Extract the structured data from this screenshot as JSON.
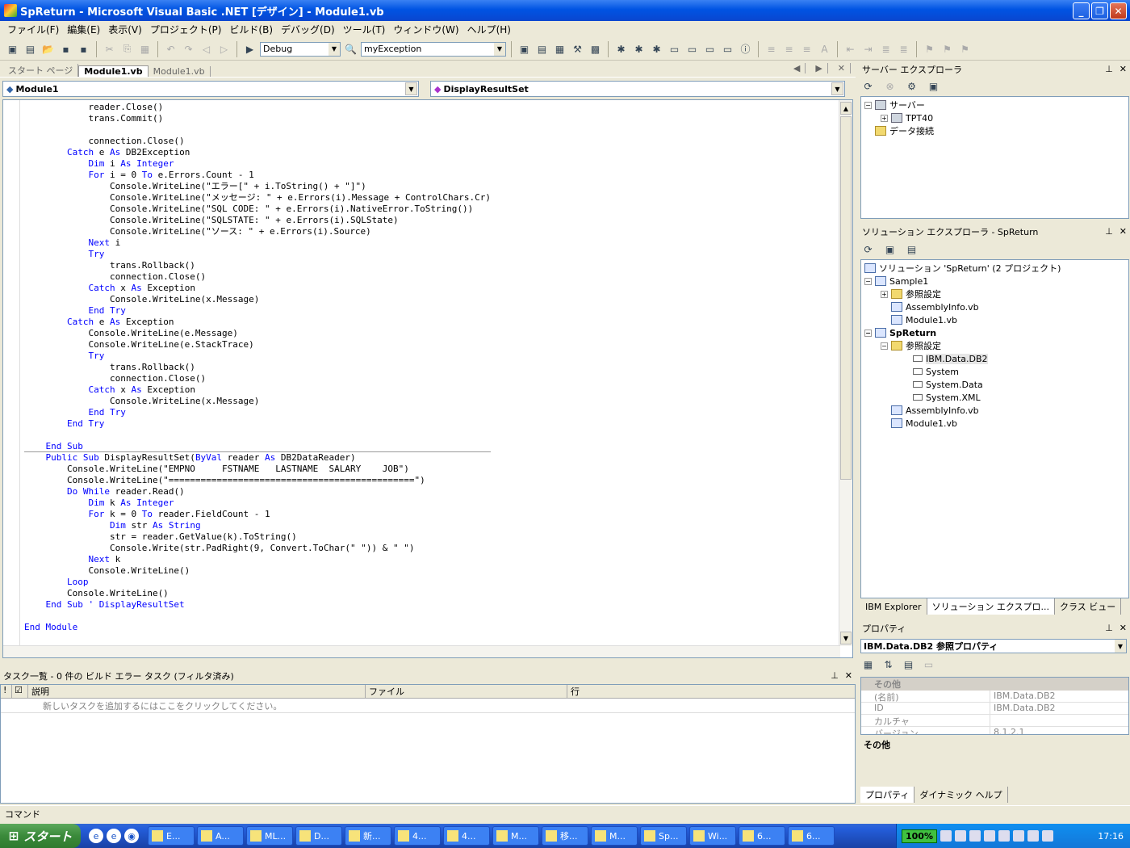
{
  "window": {
    "title": "SpReturn - Microsoft Visual Basic .NET [デザイン] - Module1.vb",
    "min": "_",
    "max": "❐",
    "close": "✕"
  },
  "menu": [
    "ファイル(F)",
    "編集(E)",
    "表示(V)",
    "プロジェクト(P)",
    "ビルド(B)",
    "デバッグ(D)",
    "ツール(T)",
    "ウィンドウ(W)",
    "ヘルプ(H)"
  ],
  "toolbar": {
    "config": "Debug",
    "find": "myException"
  },
  "doc_tabs": [
    "スタート ページ",
    "Module1.vb",
    "Module1.vb"
  ],
  "nav": {
    "left": "Module1",
    "right": "DisplayResultSet"
  },
  "code_lines": [
    [
      [
        "",
        "            reader.Close()"
      ]
    ],
    [
      [
        "",
        "            trans.Commit()"
      ]
    ],
    [
      [
        "",
        ""
      ]
    ],
    [
      [
        "",
        "            connection.Close()"
      ]
    ],
    [
      [
        "k",
        "        Catch"
      ],
      [
        "",
        " e "
      ],
      [
        "k",
        "As"
      ],
      [
        "",
        " DB2Exception"
      ]
    ],
    [
      [
        "k",
        "            Dim"
      ],
      [
        "",
        " i "
      ],
      [
        "k",
        "As Integer"
      ]
    ],
    [
      [
        "k",
        "            For"
      ],
      [
        "",
        " i = 0 "
      ],
      [
        "k",
        "To"
      ],
      [
        "",
        " e.Errors.Count - 1"
      ]
    ],
    [
      [
        "",
        "                Console.WriteLine(\"エラー[\" + i.ToString() + \"]\")"
      ]
    ],
    [
      [
        "",
        "                Console.WriteLine(\"メッセージ: \" + e.Errors(i).Message + ControlChars.Cr)"
      ]
    ],
    [
      [
        "",
        "                Console.WriteLine(\"SQL CODE: \" + e.Errors(i).NativeError.ToString())"
      ]
    ],
    [
      [
        "",
        "                Console.WriteLine(\"SQLSTATE: \" + e.Errors(i).SQLState)"
      ]
    ],
    [
      [
        "",
        "                Console.WriteLine(\"ソース: \" + e.Errors(i).Source)"
      ]
    ],
    [
      [
        "k",
        "            Next"
      ],
      [
        "",
        " i"
      ]
    ],
    [
      [
        "k",
        "            Try"
      ]
    ],
    [
      [
        "",
        "                trans.Rollback()"
      ]
    ],
    [
      [
        "",
        "                connection.Close()"
      ]
    ],
    [
      [
        "k",
        "            Catch"
      ],
      [
        "",
        " x "
      ],
      [
        "k",
        "As"
      ],
      [
        "",
        " Exception"
      ]
    ],
    [
      [
        "",
        "                Console.WriteLine(x.Message)"
      ]
    ],
    [
      [
        "k",
        "            End Try"
      ]
    ],
    [
      [
        "k",
        "        Catch"
      ],
      [
        "",
        " e "
      ],
      [
        "k",
        "As"
      ],
      [
        "",
        " Exception"
      ]
    ],
    [
      [
        "",
        "            Console.WriteLine(e.Message)"
      ]
    ],
    [
      [
        "",
        "            Console.WriteLine(e.StackTrace)"
      ]
    ],
    [
      [
        "k",
        "            Try"
      ]
    ],
    [
      [
        "",
        "                trans.Rollback()"
      ]
    ],
    [
      [
        "",
        "                connection.Close()"
      ]
    ],
    [
      [
        "k",
        "            Catch"
      ],
      [
        "",
        " x "
      ],
      [
        "k",
        "As"
      ],
      [
        "",
        " Exception"
      ]
    ],
    [
      [
        "",
        "                Console.WriteLine(x.Message)"
      ]
    ],
    [
      [
        "k",
        "            End Try"
      ]
    ],
    [
      [
        "k",
        "        End Try"
      ]
    ],
    [
      [
        "",
        ""
      ]
    ],
    [
      [
        "k",
        "    End Sub"
      ]
    ],
    [
      [
        "k",
        "    Public Sub"
      ],
      [
        "",
        " DisplayResultSet("
      ],
      [
        "k",
        "ByVal"
      ],
      [
        "",
        " reader "
      ],
      [
        "k",
        "As"
      ],
      [
        "",
        " DB2DataReader)"
      ]
    ],
    [
      [
        "",
        "        Console.WriteLine(\"EMPNO     FSTNAME   LASTNAME  SALARY    JOB\")"
      ]
    ],
    [
      [
        "",
        "        Console.WriteLine(\"==============================================\")"
      ]
    ],
    [
      [
        "k",
        "        Do While"
      ],
      [
        "",
        " reader.Read()"
      ]
    ],
    [
      [
        "k",
        "            Dim"
      ],
      [
        "",
        " k "
      ],
      [
        "k",
        "As Integer"
      ]
    ],
    [
      [
        "k",
        "            For"
      ],
      [
        "",
        " k = 0 "
      ],
      [
        "k",
        "To"
      ],
      [
        "",
        " reader.FieldCount - 1"
      ]
    ],
    [
      [
        "k",
        "                Dim"
      ],
      [
        "",
        " str "
      ],
      [
        "k",
        "As String"
      ]
    ],
    [
      [
        "",
        "                str = reader.GetValue(k).ToString()"
      ]
    ],
    [
      [
        "",
        "                Console.Write(str.PadRight(9, Convert.ToChar(\" \")) & \" \")"
      ]
    ],
    [
      [
        "k",
        "            Next"
      ],
      [
        "",
        " k"
      ]
    ],
    [
      [
        "",
        "            Console.WriteLine()"
      ]
    ],
    [
      [
        "k",
        "        Loop"
      ]
    ],
    [
      [
        "",
        "        Console.WriteLine()"
      ]
    ],
    [
      [
        "k",
        "    End Sub ' DisplayResultSet"
      ]
    ],
    [
      [
        "",
        ""
      ]
    ],
    [
      [
        "k",
        "End Module"
      ]
    ]
  ],
  "server_explorer": {
    "title": "サーバー エクスプローラ",
    "items": [
      "サーバー",
      "TPT40",
      "データ接続"
    ]
  },
  "solution_explorer": {
    "title": "ソリューション エクスプローラ - SpReturn",
    "items": [
      "ソリューション 'SpReturn' (2 プロジェクト)",
      "Sample1",
      "参照設定",
      "AssemblyInfo.vb",
      "Module1.vb",
      "SpReturn",
      "参照設定",
      "IBM.Data.DB2",
      "System",
      "System.Data",
      "System.XML",
      "AssemblyInfo.vb",
      "Module1.vb"
    ]
  },
  "right_tabs": [
    "IBM Explorer",
    "ソリューション エクスプロ...",
    "クラス ビュー"
  ],
  "properties": {
    "title": "プロパティ",
    "object": "IBM.Data.DB2  参照プロパティ",
    "category": "その他",
    "rows": [
      [
        "(名前)",
        "IBM.Data.DB2"
      ],
      [
        "ID",
        "IBM.Data.DB2"
      ],
      [
        "カルチャ",
        ""
      ],
      [
        "バージョン",
        "8.1.2.1"
      ]
    ],
    "desc": "その他",
    "tabs": [
      "プロパティ",
      "ダイナミック ヘルプ"
    ]
  },
  "tasklist": {
    "title": "タスク一覧 - 0 件の ビルド エラー タスク (フィルタ済み)",
    "cols": [
      "!",
      "説明",
      "ファイル",
      "行"
    ],
    "placeholder": "新しいタスクを追加するにはここをクリックしてください。"
  },
  "command": "コマンド",
  "taskbar": {
    "start": "スタート",
    "tasks": [
      "E...",
      "A...",
      "ML...",
      "D...",
      "新...",
      "4...",
      "4...",
      "M...",
      "移...",
      "M...",
      "Sp...",
      "Wi...",
      "6...",
      "6..."
    ],
    "battery": "100%",
    "clock": "17:16"
  }
}
